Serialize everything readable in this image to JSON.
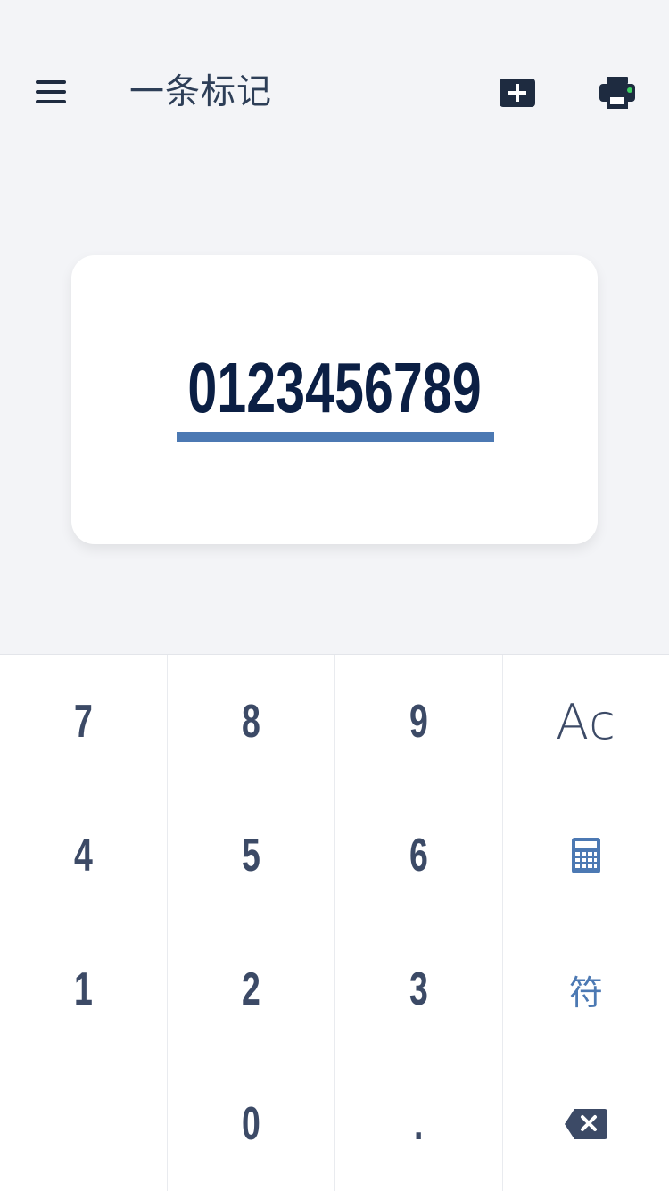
{
  "header": {
    "title": "一条标记",
    "menu_icon": "hamburger-menu-icon",
    "add_icon": "plus-box-icon",
    "print_icon": "printer-icon",
    "print_status_color": "#3ecf62"
  },
  "display": {
    "value": "0123456789",
    "underline_color": "#4c79b3",
    "text_color": "#0b1f44"
  },
  "keypad": {
    "keys": [
      "7",
      "8",
      "9",
      "Ac",
      "4",
      "5",
      "6",
      "1",
      "2",
      "3",
      "符",
      "0",
      "."
    ],
    "calculator_icon": "calculator-icon",
    "backspace_icon": "backspace-icon",
    "key_color": "#3c4a66",
    "accent_color": "#4c79b3"
  },
  "colors": {
    "background": "#f3f4f7",
    "card": "#ffffff"
  }
}
